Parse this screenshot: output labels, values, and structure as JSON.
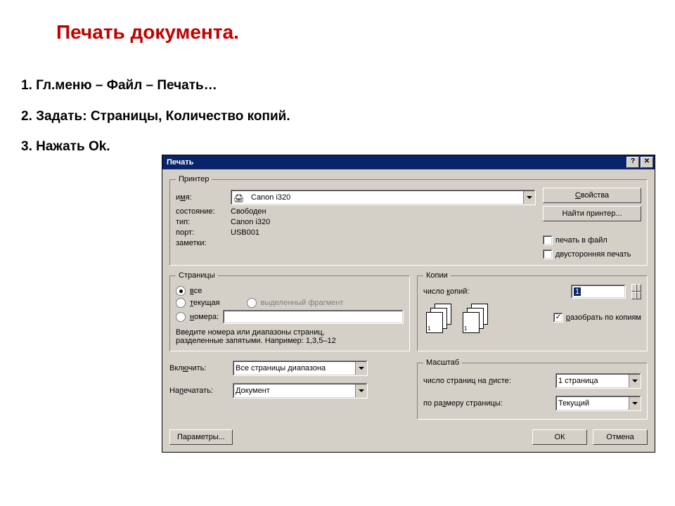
{
  "page_title": "Печать документа.",
  "instructions": [
    "1. Гл.меню – Файл – Печать…",
    "2. Задать: Страницы, Количество копий.",
    "3. Нажать Ok."
  ],
  "dialog": {
    "title": "Печать",
    "help_btn": "?",
    "close_btn": "✕",
    "printer": {
      "legend": "Принтер",
      "name_label_pre": "и",
      "name_label_u": "м",
      "name_label_post": "я:",
      "name_value": "Canon i320",
      "state_label": "состояние:",
      "state_value": "Свободен",
      "type_label": "тип:",
      "type_value": "Canon i320",
      "port_label": "порт:",
      "port_value": "USB001",
      "notes_label": "заметки:",
      "properties_btn_u": "С",
      "properties_btn_post": "войства",
      "find_printer_btn": "Найти принтер...",
      "print_to_file": "печать в файл",
      "duplex": "двусторонняя печать"
    },
    "pages": {
      "legend": "Страницы",
      "all_u": "в",
      "all_post": "се",
      "current_u": "т",
      "current_post": "екущая",
      "selection": "выделенный фрагмент",
      "numbers_u": "н",
      "numbers_post": "омера:",
      "hint1": "Введите номера или диапазоны страниц,",
      "hint2": "разделенные запятыми. Например: 1,3,5–12"
    },
    "copies": {
      "legend": "Копии",
      "count_label_pre": "число ",
      "count_label_u": "к",
      "count_label_post": "опий:",
      "count_value": "1",
      "collate_u": "р",
      "collate_post": "азобрать по копиям",
      "collate_checked": true
    },
    "include": {
      "include_label_pre": "Вкл",
      "include_label_u": "ю",
      "include_label_post": "чить:",
      "include_value": "Все страницы диапазона",
      "print_label_pre": "На",
      "print_label_u": "п",
      "print_label_post": "ечатать:",
      "print_value": "Документ"
    },
    "scale": {
      "legend": "Масштаб",
      "pages_per_sheet_label_pre": "число страниц на ",
      "pages_per_sheet_label_u": "л",
      "pages_per_sheet_label_post": "исте:",
      "pages_per_sheet_value": "1 страница",
      "fit_label_pre": "по ра",
      "fit_label_u": "з",
      "fit_label_post": "меру страницы:",
      "fit_value": "Текущий"
    },
    "footer": {
      "options_btn": "Параметры...",
      "ok_btn": "ОК",
      "cancel_btn": "Отмена"
    }
  }
}
